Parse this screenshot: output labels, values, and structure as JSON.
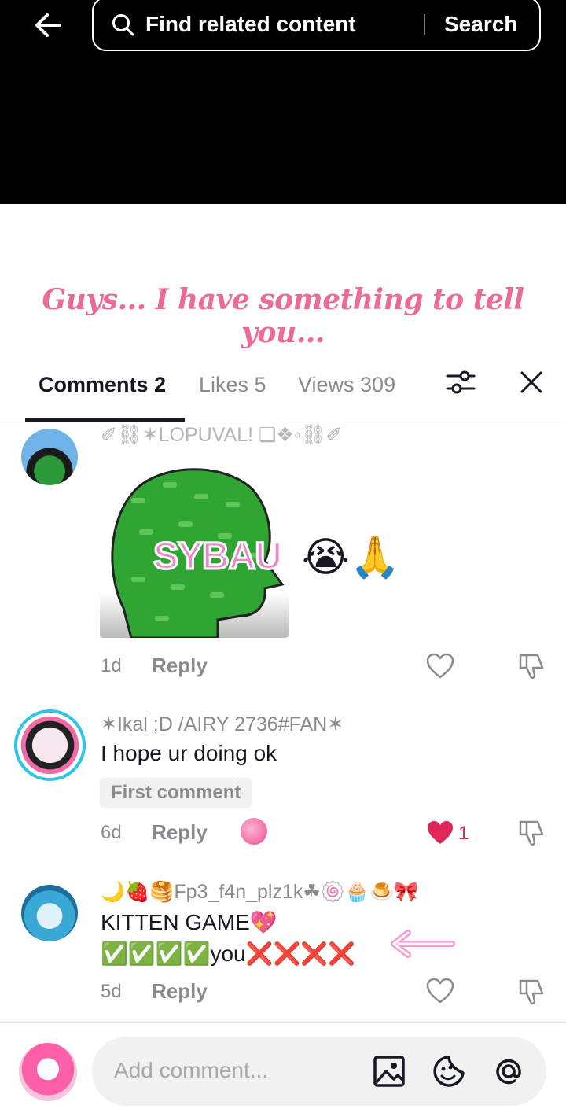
{
  "search": {
    "placeholder": "Find related content",
    "button": "Search"
  },
  "caption": "Guys... I have something to tell you...",
  "tabs": [
    {
      "label": "Comments 2"
    },
    {
      "label": "Likes 5"
    },
    {
      "label": "Views 309"
    }
  ],
  "comments": [
    {
      "username": "✐⛓✶LOPUVAL! ❏❖◦⛓✐",
      "sticker_text": "SYBAU",
      "emojis": "😭🙏",
      "time": "1d",
      "reply": "Reply"
    },
    {
      "username": "✶Ikal ;D /AIRY 2736#FAN✶",
      "text": "I hope ur doing ok",
      "badge": "First comment",
      "time": "6d",
      "reply": "Reply",
      "likes": "1"
    },
    {
      "username": "🌙🍓🥞Fp3_f4n_plz1k☘🍥🧁🍮🎀",
      "text_line1": "KITTEN GAME💖",
      "text_line2": "✅✅✅✅you❌❌❌❌",
      "time": "5d",
      "reply": "Reply"
    }
  ],
  "composer": {
    "placeholder": "Add comment..."
  },
  "colors": {
    "accent_pink": "#ec6a98",
    "like_red": "#e1265a",
    "muted": "#8a8b91"
  }
}
